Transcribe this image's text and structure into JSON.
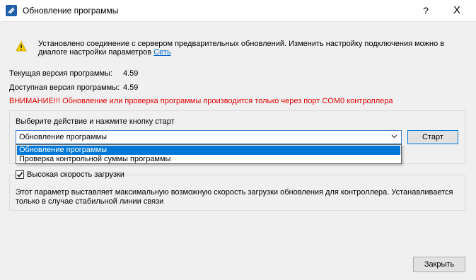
{
  "window": {
    "title": "Обновление программы",
    "help": "?",
    "close": "X"
  },
  "info": {
    "line1": "Установлено соединение с сервером предварительных обновлений. Изменить настройку подключения можно в",
    "line2": "диалоге настройки параметров",
    "link": "Сеть",
    "icon": "warning-icon"
  },
  "versions": {
    "current_label": "Текущая версия программы:",
    "current_value": "4.59",
    "available_label": "Доступная версия программы:",
    "available_value": "4.59"
  },
  "warning": "ВНИМАНИЕ!!! Обновление или проверка программы производится только через порт COM0 контроллера",
  "action": {
    "prompt": "Выберите действие и нажмите кнопку старт",
    "selected": "Обновление программы",
    "options": [
      "Обновление программы",
      "Проверка контрольной суммы программы"
    ],
    "start": "Старт"
  },
  "speed": {
    "checkbox_label": "Высокая скорость загрузки",
    "checked": true,
    "desc1": "Этот параметр выставляет максимальную возможную скорость загрузки обновления для контроллера. Устанавливается",
    "desc2": "только в случае стабильной линии связи"
  },
  "footer": {
    "close": "Закрыть"
  },
  "colors": {
    "warning_text": "#e30000",
    "link": "#0066cc",
    "selection": "#0078d7"
  }
}
